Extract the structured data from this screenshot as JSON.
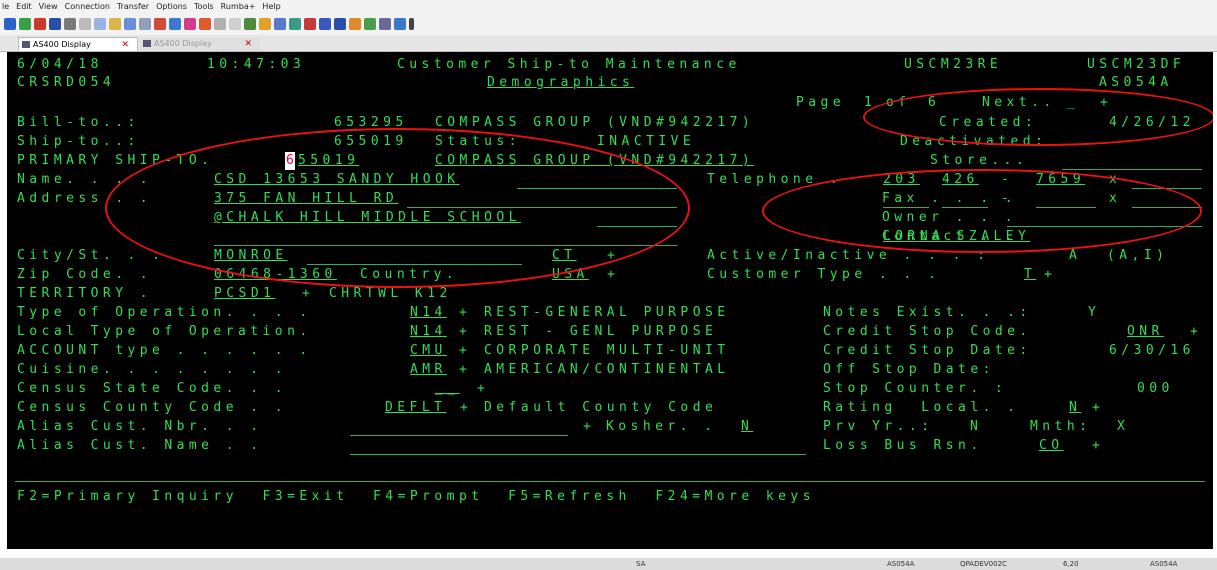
{
  "menu": [
    "le",
    "Edit",
    "View",
    "Connection",
    "Transfer",
    "Options",
    "Tools",
    "Rumba+",
    "Help"
  ],
  "tabs": [
    {
      "label": "AS400 Display",
      "close": "✕"
    },
    {
      "label": "AS400 Display",
      "close": "✕"
    }
  ],
  "screen": {
    "date": "6/04/18",
    "time": "10:47:03",
    "title": "Customer Ship-to Maintenance",
    "program_left": "USCM23RE",
    "program_right": "USCM23DF",
    "screen_id": "CRSRD054",
    "subtitle": "Demographics",
    "device": "AS054A",
    "page_label": "Page",
    "page_num": "1",
    "page_of": "of",
    "page_total": "6",
    "next_label": "Next..",
    "next_value": "_",
    "bill_to_label": "Bill-to..:",
    "bill_to_value": "653295",
    "bill_to_name": "COMPASS GROUP (VND#942217)",
    "created_label": "Created:",
    "created_value": "4/26/12",
    "ship_to_label": "Ship-to..:",
    "ship_to_value": "655019",
    "status_label": "Status:",
    "status_value": "INACTIVE",
    "deactivated_label": "Deactivated:",
    "primary_label": "PRIMARY SHIP-TO.",
    "primary_cursor": "6",
    "primary_value": "55019",
    "primary_name": "COMPASS GROUP (VND#942217)",
    "store_label": "Store...",
    "name_label": "Name. . . .",
    "name_value": "CSD 13653 SANDY HOOK",
    "telephone_label": "Telephone .",
    "phone_area": "203",
    "phone_prefix": "426",
    "phone_line": "7659",
    "phone_dash": "-",
    "phone_ext_label": "x",
    "address_label": "Address . .",
    "address_line1": "375 FAN HILL RD",
    "address_line2": "@CHALK HILL MIDDLE SCHOOL",
    "fax_label": "Fax . . . .",
    "fax_ext_label": "x",
    "owner_label": "Owner . . .",
    "contact_label": "Contact . .",
    "contact_value": "LORNA SZALEY",
    "city_label": "City/St. . .",
    "city_value": "MONROE",
    "state_value": "CT",
    "plus": "+",
    "active_label": "Active/Inactive . . . :",
    "active_value": "A",
    "active_options": "(A,I)",
    "zip_label": "Zip Code. .",
    "zip_value": "06468-1360",
    "country_label": "Country.",
    "country_value": "USA",
    "customer_type_label": "Customer Type . . .",
    "customer_type_value": "T",
    "territory_label": "TERRITORY .",
    "territory_value": "PCSD1",
    "territory_desc": "CHRTWL K12",
    "op_type_label": "Type of Operation. . . .",
    "op_type_value": "N14",
    "op_type_desc": "REST-GENERAL PURPOSE",
    "notes_label": "Notes Exist. . .:",
    "notes_value": "Y",
    "local_op_label": "Local Type of Operation.",
    "local_op_value": "N14",
    "local_op_desc": "REST - GENL PURPOSE",
    "credit_stop_code_label": "Credit Stop Code.",
    "credit_stop_code_value": "ONR",
    "account_label": "ACCOUNT type . . . . . .",
    "account_value": "CMU",
    "account_desc": "CORPORATE MULTI-UNIT",
    "credit_stop_date_label": "Credit Stop Date:",
    "credit_stop_date_value": "6/30/16",
    "cuisine_label": "Cuisine. . . . . . . .",
    "cuisine_value": "AMR",
    "cuisine_desc": "AMERICAN/CONTINENTAL",
    "off_stop_label": "Off Stop Date:",
    "census_state_label": "Census State Code. . .",
    "census_state_value": "__",
    "stop_counter_label": "Stop Counter. :",
    "stop_counter_value": "000",
    "census_county_label": "Census County Code . .",
    "census_county_value": "DEFLT",
    "census_county_desc": "Default County Code",
    "rating_label": "Rating  Local. .",
    "rating_value": "N",
    "alias_nbr_label": "Alias Cust. Nbr. . .",
    "kosher_label": "Kosher. .",
    "kosher_value": "N",
    "prv_yr_label": "Prv Yr..:",
    "prv_yr_value": "N",
    "mnth_label": "Mnth:",
    "mnth_value": "X",
    "alias_name_label": "Alias Cust. Name . .",
    "loss_label": "Loss Bus Rsn.",
    "loss_value": "CO",
    "fkeys": "F2=Primary Inquiry  F3=Exit  F4=Prompt  F5=Refresh  F24=More keys"
  },
  "status": {
    "sa": "SA",
    "session1": "AS054A",
    "host": "QPADEV002C",
    "cursor_pos": "6,20",
    "session2": "AS054A"
  },
  "colors": {
    "screen_text": "#33dd55",
    "screen_bg": "#000000",
    "annotation": "#ee1111"
  }
}
